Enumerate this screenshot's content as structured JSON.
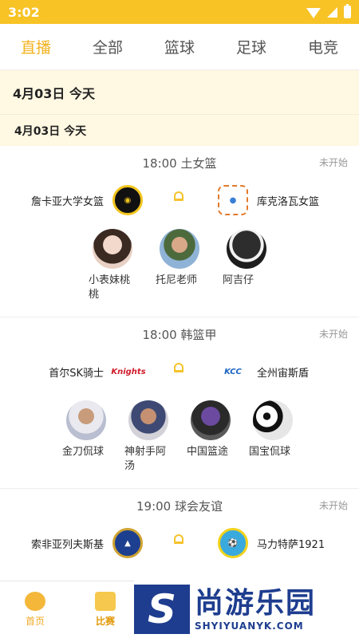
{
  "status_bar": {
    "time": "3:02"
  },
  "tabs": [
    {
      "label": "直播",
      "active": true
    },
    {
      "label": "全部",
      "active": false
    },
    {
      "label": "篮球",
      "active": false
    },
    {
      "label": "足球",
      "active": false
    },
    {
      "label": "电竞",
      "active": false
    }
  ],
  "date_header": "4月03日  今天",
  "date_subheader": "4月03日  今天",
  "matches": [
    {
      "time_league": "18:00  土女篮",
      "status": "未开始",
      "home": {
        "name": "詹卡亚大学女篮",
        "logo": "basketball-club-logo"
      },
      "away": {
        "name": "库克洛瓦女篮",
        "logo": "basketball-club-logo"
      },
      "anchors": [
        {
          "name": "小表妹桃桃"
        },
        {
          "name": "托尼老师"
        },
        {
          "name": "阿吉仔"
        }
      ]
    },
    {
      "time_league": "18:00  韩篮甲",
      "status": "未开始",
      "home": {
        "name": "首尔SK骑士",
        "logo": "knights-logo"
      },
      "away": {
        "name": "全州宙斯盾",
        "logo": "kcc-logo"
      },
      "anchors": [
        {
          "name": "金刀侃球"
        },
        {
          "name": "神射手阿汤"
        },
        {
          "name": "中国篮途"
        },
        {
          "name": "国宝侃球"
        }
      ]
    },
    {
      "time_league": "19:00  球会友谊",
      "status": "未开始",
      "home": {
        "name": "索非亚列夫斯基",
        "logo": "football-club-logo"
      },
      "away": {
        "name": "马力特萨1921",
        "logo": "football-club-logo"
      }
    }
  ],
  "bottom_nav": [
    {
      "label": "首页",
      "icon": "basketball-icon"
    },
    {
      "label": "比赛",
      "icon": "scoreboard-icon",
      "active": true
    }
  ],
  "watermark": {
    "cn": "尚游乐园",
    "en": "SHYIYUANYK.COM"
  },
  "colors": {
    "accent": "#f7c325",
    "tab_active": "#f2b321",
    "date_bg": "#fff8e2",
    "watermark": "#1e3d8f"
  }
}
